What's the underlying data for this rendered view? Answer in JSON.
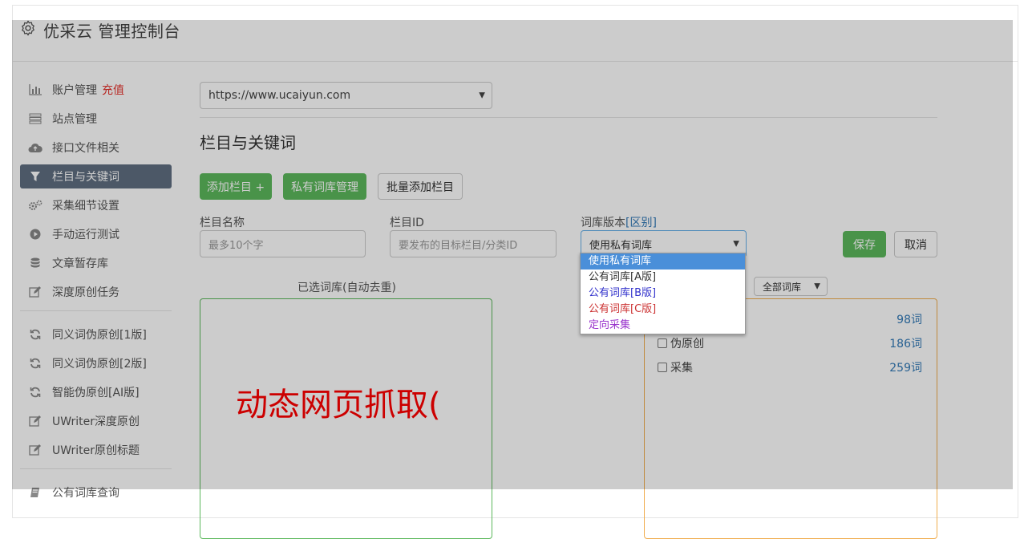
{
  "header": {
    "title": "优采云 管理控制台",
    "icon": "gear-icon"
  },
  "sidebar": {
    "items": [
      {
        "label": "账户管理",
        "extra": "充值",
        "icon": "bar-chart-icon"
      },
      {
        "label": "站点管理",
        "icon": "server-icon"
      },
      {
        "label": "接口文件相关",
        "icon": "cloud-upload-icon"
      },
      {
        "label": "栏目与关键词",
        "icon": "filter-icon",
        "active": true
      },
      {
        "label": "采集细节设置",
        "icon": "gears-icon"
      },
      {
        "label": "手动运行测试",
        "icon": "play-circle-icon"
      },
      {
        "label": "文章暂存库",
        "icon": "database-icon"
      },
      {
        "label": "深度原创任务",
        "icon": "edit-icon"
      }
    ],
    "items2": [
      {
        "label": "同义词伪原创[1版]",
        "icon": "refresh-icon"
      },
      {
        "label": "同义词伪原创[2版]",
        "icon": "refresh-icon"
      },
      {
        "label": "智能伪原创[AI版]",
        "icon": "refresh-icon"
      },
      {
        "label": "UWriter深度原创",
        "icon": "edit-icon"
      },
      {
        "label": "UWriter原创标题",
        "icon": "edit-icon"
      }
    ],
    "items3": [
      {
        "label": "公有词库查询",
        "icon": "book-icon"
      }
    ]
  },
  "main": {
    "site_select": "https://www.ucaiyun.com",
    "section_title": "栏目与关键词",
    "buttons": {
      "add_column": "添加栏目 +",
      "private_lib": "私有词库管理",
      "batch_add": "批量添加栏目"
    },
    "form": {
      "column_name_label": "栏目名称",
      "column_name_placeholder": "最多10个字",
      "column_id_label": "栏目ID",
      "column_id_placeholder": "要发布的目标栏目/分类ID",
      "lib_version_label": "词库版本",
      "lib_version_link": "[区别]",
      "lib_version_value": "使用私有词库",
      "save": "保存",
      "cancel": "取消"
    },
    "selected_box_title": "已选词库(自动去重)",
    "filter_select": "全部词库",
    "libraries": [
      {
        "name": "",
        "count": "98词"
      },
      {
        "name": "伪原创",
        "count": "186词"
      },
      {
        "name": "采集",
        "count": "259词"
      }
    ],
    "overlay_text": "动态网页抓取(",
    "dropdown": {
      "options": [
        {
          "label": "使用私有词库",
          "color": "#ffffff",
          "selected": true
        },
        {
          "label": "公有词库[A版]",
          "color": "#333333"
        },
        {
          "label": "公有词库[B版]",
          "color": "#3333cc"
        },
        {
          "label": "公有词库[C版]",
          "color": "#cc3333"
        },
        {
          "label": "定向采集",
          "color": "#9933cc"
        }
      ]
    }
  }
}
